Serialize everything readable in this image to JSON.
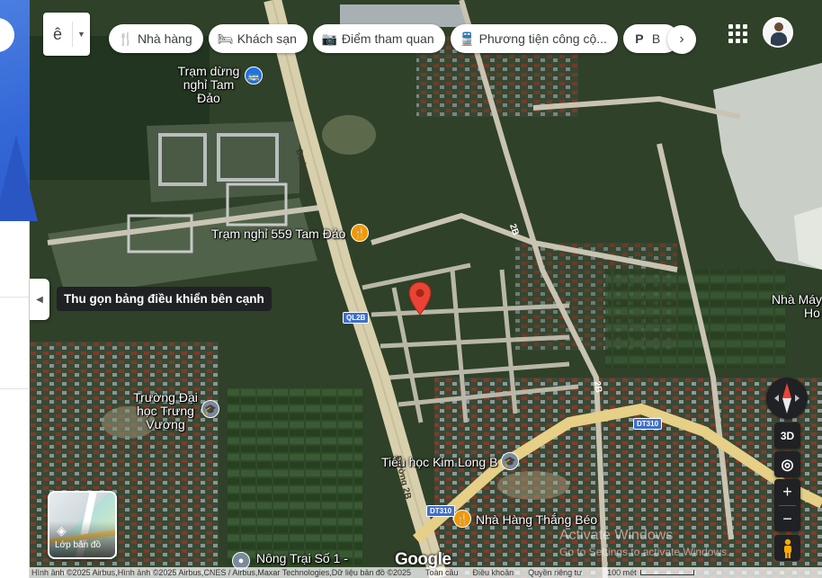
{
  "ime": {
    "letter": "ê"
  },
  "pills": [
    {
      "icon": "restaurant-icon",
      "glyph": "🍴",
      "label": "Nhà hàng"
    },
    {
      "icon": "hotel-icon",
      "glyph": "🛏",
      "label": "Khách sạn"
    },
    {
      "icon": "camera-icon",
      "glyph": "📷",
      "label": "Điểm tham quan"
    },
    {
      "icon": "transit-icon",
      "glyph": "🚆",
      "label": "Phương tiện công cộ..."
    },
    {
      "icon": "parking-icon",
      "glyph": "P",
      "label": "B"
    }
  ],
  "map_labels": {
    "rest_stop": "Trạm dừng nghỉ Tam Đảo",
    "rest_559": "Trạm nghỉ 559 Tam Đảo",
    "university": "Trường Đại học Trưng Vương",
    "primary_school": "Tiểu học Kim Long B",
    "restaurant": "Nhà Hàng Thắng Béo",
    "farm": "Nông Trại Số 1 -",
    "factory": "Nhà Máy",
    "factory2": "Ho",
    "road_2b": "Đường 2B",
    "road_2b_b": "Đường 2B",
    "road_2b_small": "2B",
    "road_2b_small2": "2B",
    "shield_ql2b": "QL2B",
    "shield_dt310": "DT310",
    "shield_dt310_b": "DT310"
  },
  "tooltip": "Thu gọn bảng điều khiển bên cạnh",
  "layers_label": "Lớp bản đồ",
  "controls": {
    "three_d": "3D",
    "zoom_in": "+",
    "zoom_out": "−"
  },
  "google_logo": "Google",
  "watermark": {
    "line1": "Activate Windows",
    "line2": "Go to Settings to activate Windows."
  },
  "footer": {
    "attribution": "Hình ảnh ©2025 Airbus,Hình ảnh ©2025 Airbus,CNES / Airbus,Maxar Technologies,Dữ liệu bản đồ ©2025",
    "country": "Toàn cầu",
    "terms": "Điều khoản",
    "privacy": "Quyền riêng tư",
    "scale": "100 mét"
  },
  "colors": {
    "road_main": "#d9d0b0",
    "road_yellow": "#f0d27a",
    "panel_blue": "#3366d6"
  }
}
